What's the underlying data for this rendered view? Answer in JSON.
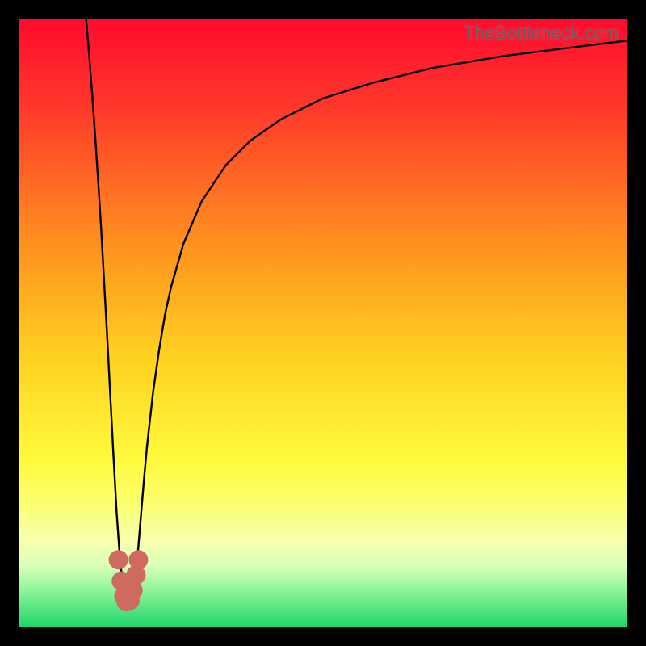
{
  "watermark": "TheBottleneck.com",
  "chart_data": {
    "type": "line",
    "title": "",
    "xlabel": "",
    "ylabel": "",
    "xlim": [
      0,
      100
    ],
    "ylim": [
      0,
      100
    ],
    "grid": false,
    "legend": false,
    "gradient_stops": [
      {
        "offset": 0.0,
        "color": "#ff0a2e"
      },
      {
        "offset": 0.15,
        "color": "#ff3a2a"
      },
      {
        "offset": 0.35,
        "color": "#ff8a1f"
      },
      {
        "offset": 0.55,
        "color": "#ffcf1f"
      },
      {
        "offset": 0.72,
        "color": "#fff93b"
      },
      {
        "offset": 0.8,
        "color": "#fbff70"
      },
      {
        "offset": 0.86,
        "color": "#f7ffb0"
      },
      {
        "offset": 0.9,
        "color": "#d8ffb8"
      },
      {
        "offset": 0.94,
        "color": "#8ef59a"
      },
      {
        "offset": 1.0,
        "color": "#1fd66a"
      }
    ],
    "series": [
      {
        "name": "bottleneck-curve",
        "x": [
          11.0,
          11.5,
          12.0,
          12.5,
          13.0,
          13.5,
          14.0,
          14.5,
          15.0,
          15.5,
          16.0,
          16.5,
          17.0,
          17.5,
          18.0,
          18.5,
          19.0,
          19.5,
          20.0,
          20.5,
          21.0,
          22.0,
          23.0,
          24.0,
          25.0,
          27.0,
          30.0,
          34.0,
          38.0,
          43.0,
          50.0,
          58.0,
          68.0,
          80.0,
          92.0,
          100.0
        ],
        "y": [
          100.0,
          94.0,
          87.5,
          80.5,
          73.0,
          65.0,
          56.0,
          47.0,
          37.5,
          28.0,
          19.0,
          12.0,
          7.0,
          4.0,
          3.0,
          4.0,
          7.0,
          12.0,
          18.0,
          24.0,
          29.5,
          38.5,
          45.5,
          51.5,
          56.0,
          63.0,
          70.0,
          76.0,
          80.0,
          83.5,
          87.0,
          89.5,
          92.0,
          94.0,
          95.5,
          96.5
        ]
      }
    ],
    "markers": [
      {
        "x": 16.3,
        "y": 11.0,
        "r": 1.6
      },
      {
        "x": 16.8,
        "y": 7.5,
        "r": 1.6
      },
      {
        "x": 17.2,
        "y": 5.0,
        "r": 1.6
      },
      {
        "x": 17.6,
        "y": 4.1,
        "r": 1.6
      },
      {
        "x": 18.2,
        "y": 4.3,
        "r": 1.6
      },
      {
        "x": 18.7,
        "y": 6.0,
        "r": 1.6
      },
      {
        "x": 19.2,
        "y": 8.5,
        "r": 1.6
      },
      {
        "x": 19.6,
        "y": 11.0,
        "r": 1.6
      }
    ],
    "marker_color": "#cf6a60"
  }
}
